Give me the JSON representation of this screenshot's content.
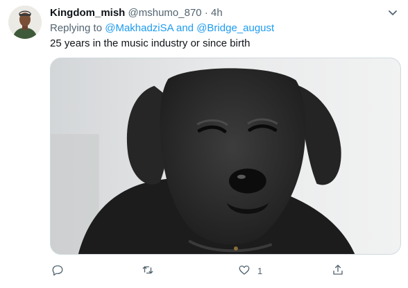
{
  "tweet": {
    "author_name": "Kingdom_mish",
    "handle": "@mshumo_870",
    "separator": "·",
    "time": "4h",
    "replying_to_prefix": "Replying to",
    "mention_1": "@MakhadziSA",
    "mention_join": "and",
    "mention_2": "@Bridge_august",
    "text": "25 years in the music industry or since birth",
    "image_subject": "black labrador dog squinting",
    "actions": {
      "reply_icon": "reply-icon",
      "retweet_icon": "retweet-icon",
      "like_icon": "heart-icon",
      "like_count": "1",
      "share_icon": "share-icon"
    }
  },
  "colors": {
    "accent": "#1d9bf0",
    "secondary_text": "#536471",
    "primary_text": "#0f1419",
    "border": "#cfd9de"
  }
}
